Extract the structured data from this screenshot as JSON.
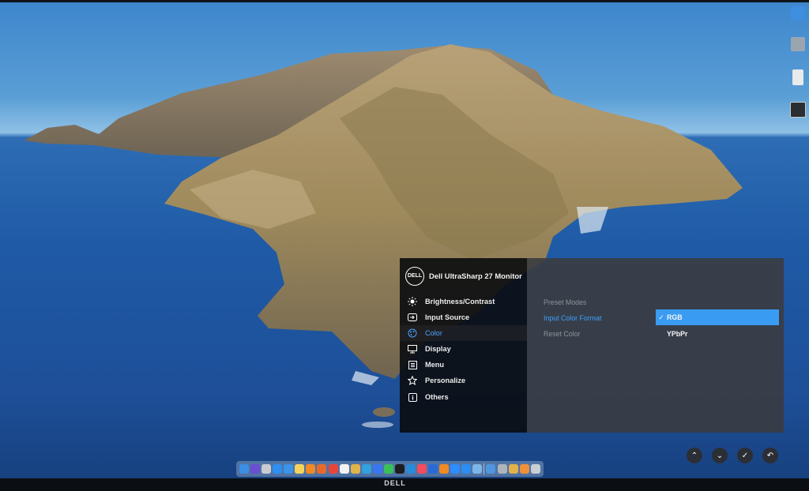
{
  "osd": {
    "header": {
      "logo": "DELL",
      "title": "Dell UltraSharp 27 Monitor"
    },
    "menu": [
      {
        "label": "Brightness/Contrast",
        "icon": "brightness-icon"
      },
      {
        "label": "Input Source",
        "icon": "input-source-icon"
      },
      {
        "label": "Color",
        "icon": "color-palette-icon",
        "selected": true
      },
      {
        "label": "Display",
        "icon": "display-icon"
      },
      {
        "label": "Menu",
        "icon": "menu-list-icon"
      },
      {
        "label": "Personalize",
        "icon": "star-icon"
      },
      {
        "label": "Others",
        "icon": "others-icon"
      }
    ],
    "submenu": [
      {
        "label": "Preset Modes",
        "state": "dim"
      },
      {
        "label": "Input Color Format",
        "state": "active"
      },
      {
        "label": "Reset Color",
        "state": "dim"
      }
    ],
    "options": [
      {
        "label": "RGB",
        "selected": true,
        "check": "✓"
      },
      {
        "label": "YPbPr",
        "selected": false,
        "check": ""
      }
    ],
    "buttons": [
      {
        "icon": "chevron-up-icon",
        "glyph": "⌃"
      },
      {
        "icon": "chevron-down-icon",
        "glyph": "⌄"
      },
      {
        "icon": "check-icon",
        "glyph": "✓"
      },
      {
        "icon": "back-icon",
        "glyph": "↶"
      }
    ],
    "colors": {
      "accent": "#3a9bf3",
      "selected_text": "#4aa3ff"
    }
  },
  "bezel": {
    "logo": "DELL"
  },
  "desktop_icons": [
    {
      "icon": "folder-icon",
      "color": "#3f8fe0"
    },
    {
      "icon": "image-file-icon",
      "color": "#9aa5b0"
    },
    {
      "icon": "document-icon",
      "color": "#e8eaec"
    },
    {
      "icon": "terminal-icon",
      "color": "#2a2d31"
    }
  ],
  "dock": {
    "apps": [
      {
        "icon": "finder-icon",
        "color": "#3a8ee6"
      },
      {
        "icon": "siri-icon",
        "color": "#6a4fd1"
      },
      {
        "icon": "launchpad-icon",
        "color": "#c7ccd3"
      },
      {
        "icon": "safari-icon",
        "color": "#2f8ff0"
      },
      {
        "icon": "mail-icon",
        "color": "#3b93ea"
      },
      {
        "icon": "notes-icon",
        "color": "#f3d35b"
      },
      {
        "icon": "pages-icon",
        "color": "#f08a24"
      },
      {
        "icon": "firefox-icon",
        "color": "#e9692c"
      },
      {
        "icon": "chrome-icon",
        "color": "#e8463b"
      },
      {
        "icon": "notion-icon",
        "color": "#f2f2f2"
      },
      {
        "icon": "slack-icon",
        "color": "#e1b34b"
      },
      {
        "icon": "telegram-icon",
        "color": "#31a2e0"
      },
      {
        "icon": "signal-icon",
        "color": "#3a76f0"
      },
      {
        "icon": "whatsapp-icon",
        "color": "#3ac05b"
      },
      {
        "icon": "terminal-icon",
        "color": "#1c1d20"
      },
      {
        "icon": "vscode-icon",
        "color": "#2a8bd8"
      },
      {
        "icon": "music-icon",
        "color": "#f34c5c"
      },
      {
        "icon": "1password-icon",
        "color": "#2a6ad8"
      },
      {
        "icon": "vlc-icon",
        "color": "#f08a24"
      },
      {
        "icon": "zoom-icon",
        "color": "#2d8cff"
      },
      {
        "icon": "app-store-icon",
        "color": "#2c8df2"
      },
      {
        "icon": "preview-icon",
        "color": "#7db5e8"
      },
      {
        "icon": "xcode-icon",
        "color": "#4f96de"
      },
      {
        "icon": "automator-icon",
        "color": "#aeb4bb"
      },
      {
        "icon": "archive-icon",
        "color": "#e3b14a"
      },
      {
        "icon": "photos-icon",
        "color": "#f0903a"
      },
      {
        "icon": "trash-icon",
        "color": "#c9ced4"
      }
    ]
  }
}
